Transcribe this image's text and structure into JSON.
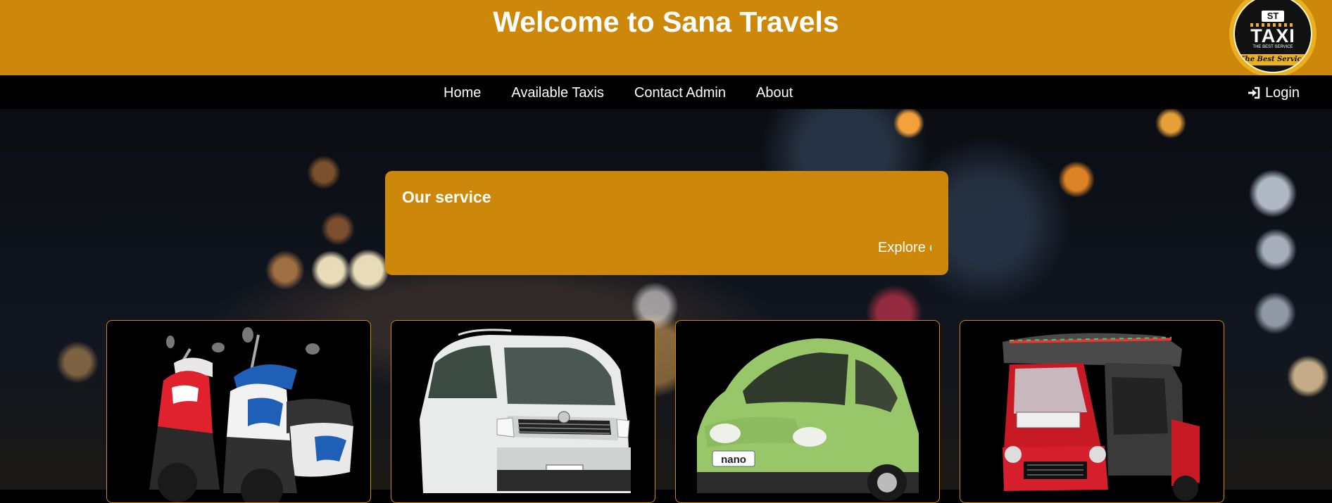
{
  "header": {
    "title": "Welcome to Sana Travels",
    "logo": {
      "badge": "ST",
      "word": "TAXI",
      "tagline": "THE BEST SERVICE",
      "banner": "The Best Service"
    }
  },
  "nav": {
    "links": [
      "Home",
      "Available Taxis",
      "Contact Admin",
      "About"
    ],
    "login_label": "Login",
    "login_icon": "sign-in-icon"
  },
  "service": {
    "title": "Our service",
    "marquee_text": "Explore ou"
  },
  "cards": [
    {
      "vehicle": "scooters",
      "icon": "scooter-image"
    },
    {
      "vehicle": "van",
      "icon": "van-image"
    },
    {
      "vehicle": "nano car",
      "icon": "car-image",
      "plate": "nano"
    },
    {
      "vehicle": "tuk-tuk",
      "icon": "tuktuk-image"
    }
  ],
  "colors": {
    "accent": "#cd880b",
    "nav_bg": "#000000",
    "text": "#ffffff"
  }
}
